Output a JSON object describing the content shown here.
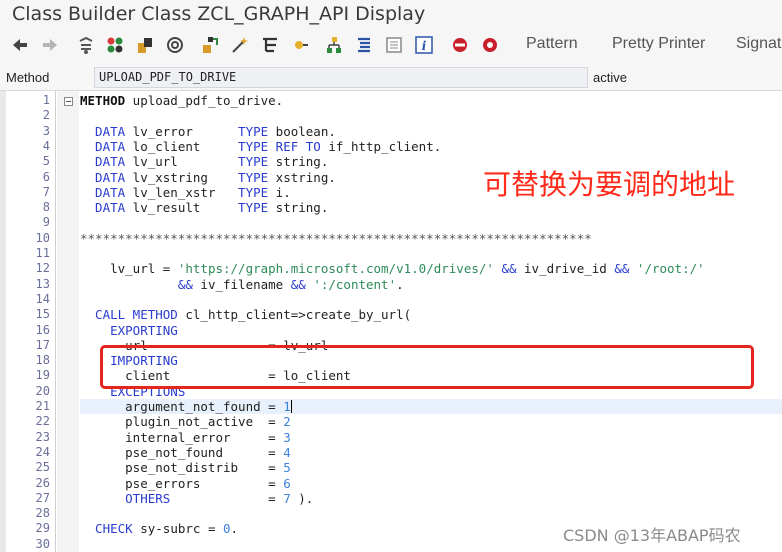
{
  "window": {
    "title": "Class Builder Class ZCL_GRAPH_API Display"
  },
  "toolbar": {
    "icons": [
      "back-arrow-icon",
      "forward-arrow-icon",
      "other-object-icon",
      "activate-icon",
      "check-icon",
      "display-change-icon",
      "object-list-icon",
      "magic-wand-icon",
      "where-used-icon",
      "navigation-icon",
      "hierarchy-icon",
      "list-icon",
      "document-icon",
      "info-icon",
      "cancel-icon",
      "settings-icon"
    ],
    "pattern_label": "Pattern",
    "pretty_printer_label": "Pretty Printer",
    "signature_label": "Signat"
  },
  "method_bar": {
    "label": "Method",
    "value": "UPLOAD_PDF_TO_DRIVE",
    "status": "active"
  },
  "editor": {
    "lines": [
      {
        "n": "1",
        "t": [
          [
            "bold",
            "METHOD"
          ],
          [
            "pl",
            " upload_pdf_to_drive."
          ]
        ]
      },
      {
        "n": "2",
        "t": []
      },
      {
        "n": "3",
        "t": [
          [
            "kw",
            "  DATA"
          ],
          [
            "pl",
            " lv_error      "
          ],
          [
            "kw",
            "TYPE"
          ],
          [
            "pl",
            " boolean."
          ]
        ]
      },
      {
        "n": "4",
        "t": [
          [
            "kw",
            "  DATA"
          ],
          [
            "pl",
            " lo_client     "
          ],
          [
            "kw",
            "TYPE REF TO"
          ],
          [
            "pl",
            " if_http_client."
          ]
        ]
      },
      {
        "n": "5",
        "t": [
          [
            "kw",
            "  DATA"
          ],
          [
            "pl",
            " lv_url        "
          ],
          [
            "kw",
            "TYPE"
          ],
          [
            "pl",
            " string."
          ]
        ]
      },
      {
        "n": "6",
        "t": [
          [
            "kw",
            "  DATA"
          ],
          [
            "pl",
            " lv_xstring    "
          ],
          [
            "kw",
            "TYPE"
          ],
          [
            "pl",
            " xstring."
          ]
        ]
      },
      {
        "n": "7",
        "t": [
          [
            "kw",
            "  DATA"
          ],
          [
            "pl",
            " lv_len_xstr   "
          ],
          [
            "kw",
            "TYPE"
          ],
          [
            "pl",
            " i."
          ]
        ]
      },
      {
        "n": "8",
        "t": [
          [
            "kw",
            "  DATA"
          ],
          [
            "pl",
            " lv_result     "
          ],
          [
            "kw",
            "TYPE"
          ],
          [
            "pl",
            " string."
          ]
        ]
      },
      {
        "n": "9",
        "t": []
      },
      {
        "n": "10",
        "t": [
          [
            "star",
            "********************************************************************"
          ]
        ]
      },
      {
        "n": "11",
        "t": []
      },
      {
        "n": "12",
        "t": [
          [
            "pl",
            "    lv_url = "
          ],
          [
            "str",
            "'https://graph.microsoft.com/v1.0/drives/'"
          ],
          [
            "kw",
            " &&"
          ],
          [
            "pl",
            " iv_drive_id "
          ],
          [
            "kw",
            "&&"
          ],
          [
            "str",
            " '/root:/'"
          ]
        ]
      },
      {
        "n": "13",
        "t": [
          [
            "kw",
            "             &&"
          ],
          [
            "pl",
            " iv_filename "
          ],
          [
            "kw",
            "&&"
          ],
          [
            "str",
            " ':/content'"
          ],
          [
            "pl",
            "."
          ]
        ]
      },
      {
        "n": "14",
        "t": []
      },
      {
        "n": "15",
        "t": [
          [
            "kw",
            "  CALL METHOD"
          ],
          [
            "pl",
            " cl_http_client=>create_by_url("
          ]
        ]
      },
      {
        "n": "16",
        "t": [
          [
            "kw",
            "    EXPORTING"
          ]
        ]
      },
      {
        "n": "17",
        "t": [
          [
            "pl",
            "      url                = lv_url"
          ]
        ]
      },
      {
        "n": "18",
        "t": [
          [
            "kw",
            "    IMPORTING"
          ]
        ]
      },
      {
        "n": "19",
        "t": [
          [
            "pl",
            "      client             = lo_client"
          ]
        ]
      },
      {
        "n": "20",
        "t": [
          [
            "kw",
            "    EXCEPTIONS"
          ]
        ]
      },
      {
        "n": "21",
        "t": [
          [
            "pl",
            "      argument_not_found = "
          ],
          [
            "num",
            "1"
          ]
        ],
        "highlight": true,
        "cursor": true
      },
      {
        "n": "22",
        "t": [
          [
            "pl",
            "      plugin_not_active  = "
          ],
          [
            "num",
            "2"
          ]
        ]
      },
      {
        "n": "23",
        "t": [
          [
            "pl",
            "      internal_error     = "
          ],
          [
            "num",
            "3"
          ]
        ]
      },
      {
        "n": "24",
        "t": [
          [
            "pl",
            "      pse_not_found      = "
          ],
          [
            "num",
            "4"
          ]
        ]
      },
      {
        "n": "25",
        "t": [
          [
            "pl",
            "      pse_not_distrib    = "
          ],
          [
            "num",
            "5"
          ]
        ]
      },
      {
        "n": "26",
        "t": [
          [
            "pl",
            "      pse_errors         = "
          ],
          [
            "num",
            "6"
          ]
        ]
      },
      {
        "n": "27",
        "t": [
          [
            "kw",
            "      OTHERS"
          ],
          [
            "pl",
            "             = "
          ],
          [
            "num",
            "7"
          ],
          [
            "pl",
            " )."
          ]
        ]
      },
      {
        "n": "28",
        "t": []
      },
      {
        "n": "29",
        "t": [
          [
            "kw",
            "  CHECK"
          ],
          [
            "pl",
            " sy-subrc = "
          ],
          [
            "num",
            "0"
          ],
          [
            "pl",
            "."
          ]
        ]
      },
      {
        "n": "30",
        "t": []
      }
    ]
  },
  "annotation": {
    "text": "可替换为要调的地址",
    "color": "#ff2a1a"
  },
  "watermark": "CSDN @13年ABAP码农",
  "colors": {
    "keyword": "#2a3bd0",
    "string": "#2e8b57",
    "number": "#3d80d9",
    "highlight_box": "#e5241b"
  }
}
